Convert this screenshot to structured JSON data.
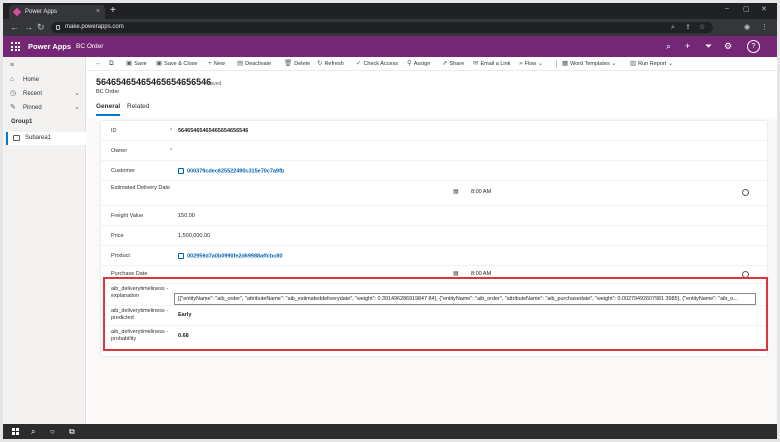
{
  "browser": {
    "tab_title": "Power Apps",
    "tab_close": "×",
    "new_tab": "+",
    "url": "make.powerapps.com",
    "window_controls": [
      "–",
      "▢",
      "✕"
    ]
  },
  "header": {
    "app_name": "Power Apps",
    "entity": "BC Order"
  },
  "sidebar": {
    "items": [
      {
        "label": "Home"
      },
      {
        "label": "Recent"
      },
      {
        "label": "Pinned"
      }
    ],
    "group": "Group1",
    "subarea": "Subarea1"
  },
  "commands": [
    {
      "label": "Save",
      "icon": "save-icon"
    },
    {
      "label": "Save & Close",
      "icon": "save-close-icon"
    },
    {
      "label": "New",
      "icon": "plus-icon"
    },
    {
      "label": "Deactivate",
      "icon": "deactivate-icon"
    },
    {
      "label": "Delete",
      "icon": "trash-icon"
    },
    {
      "label": "Refresh",
      "icon": "refresh-icon"
    },
    {
      "label": "Check Access",
      "icon": "check-access-icon"
    },
    {
      "label": "Assign",
      "icon": "assign-icon"
    },
    {
      "label": "Share",
      "icon": "share-icon"
    },
    {
      "label": "Email a Link",
      "icon": "email-icon"
    },
    {
      "label": "Flow",
      "icon": "flow-icon"
    },
    {
      "label": "Word Templates",
      "icon": "word-icon"
    },
    {
      "label": "Run Report",
      "icon": "report-icon"
    }
  ],
  "record": {
    "title": "5646546546546565465654 6",
    "title_text": "56465465465465654656546",
    "saved": "- Saved",
    "entity": "BC Order",
    "tabs": [
      "General",
      "Related"
    ]
  },
  "fields": {
    "id": {
      "label": "ID",
      "required": "*",
      "value": "56465465465465654656546"
    },
    "owner": {
      "label": "Owner",
      "required": "*",
      "value": ""
    },
    "customer": {
      "label": "Customer",
      "value": "000379cdec625522490c315e70c7a9fb"
    },
    "delivery": {
      "label": "Estimated Delivery Date",
      "time": "8:00 AM"
    },
    "freight": {
      "label": "Freight Value",
      "value": "150.00"
    },
    "price": {
      "label": "Price",
      "value": "1,500,000.00"
    },
    "product": {
      "label": "Product",
      "value": "002959d7a0b0990fe2d69988affcbc80"
    },
    "purchase": {
      "label": "Purchase Date",
      "time": "8:00 AM"
    },
    "explanation": {
      "label": "aib_deliverytimeliness - explanation",
      "value": "[{\"entityName\": \"aib_order\", \"attributeName\": \"aib_estimateddeliverydate\", \"weight\": 0.391496286919847 84}, {\"entityName\": \"aib_order\", \"attributeName\": \"aib_purchasedate\", \"weight\": 0.00279492607981 3985}, {\"entityName\": \"aib_o..."
    },
    "predicted": {
      "label": "aib_deliverytimeliness - predicted",
      "value": "Early"
    },
    "probability": {
      "label": "aib_deliverytimeliness - probability",
      "value": "0.68"
    }
  }
}
